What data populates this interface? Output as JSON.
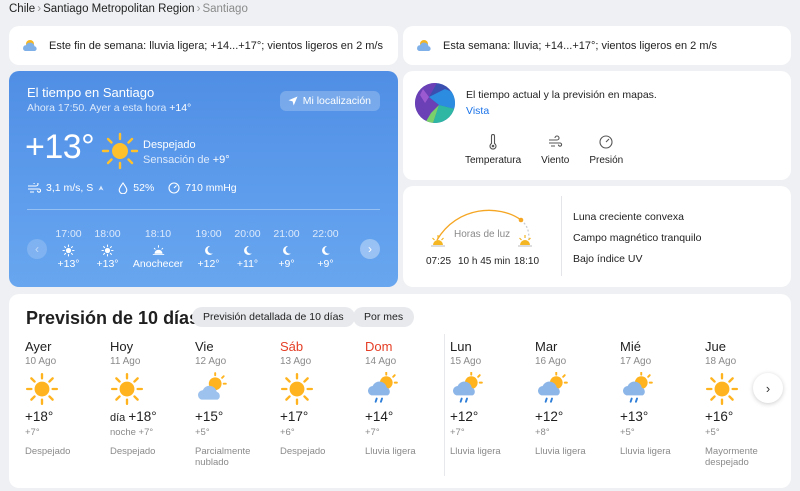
{
  "breadcrumb": {
    "items": [
      "Chile",
      "Santiago Metropolitan Region"
    ],
    "current": "Santiago",
    "separator": "›"
  },
  "weekend_strip": {
    "icon": "partly-cloudy-icon",
    "text": "Este fin de semana: lluvia ligera; +14...+17°; vientos ligeros en 2 m/s"
  },
  "week_strip": {
    "icon": "partly-cloudy-icon",
    "text": "Esta semana: lluvia; +14...+17°; vientos ligeros en 2 m/s"
  },
  "current": {
    "title": "El tiempo en Santiago",
    "subtitle_prefix": "Ahora 17:50. Ayer a esta hora ",
    "subtitle_value": "+14°",
    "location_button": "Mi localización",
    "temperature": "+13°",
    "condition": "Despejado",
    "feels_label": "Sensación de ",
    "feels_value": "+9°",
    "wind": "3,1 m/s, S",
    "humidity": "52%",
    "pressure": "710 mmHg"
  },
  "hourly": [
    {
      "time": "17:00",
      "icon": "sun-icon",
      "value": "+13°"
    },
    {
      "time": "18:00",
      "icon": "sun-icon",
      "value": "+13°"
    },
    {
      "time": "18:10",
      "icon": "sunset-icon",
      "value": "Anochecer"
    },
    {
      "time": "19:00",
      "icon": "moon-icon",
      "value": "+12°"
    },
    {
      "time": "20:00",
      "icon": "moon-icon",
      "value": "+11°"
    },
    {
      "time": "21:00",
      "icon": "moon-icon",
      "value": "+9°"
    },
    {
      "time": "22:00",
      "icon": "moon-icon",
      "value": "+9°"
    }
  ],
  "map_card": {
    "text": "El tiempo actual y la previsión en mapas.",
    "link": "Vista",
    "options": [
      {
        "label": "Temperatura",
        "icon": "thermometer-icon"
      },
      {
        "label": "Viento",
        "icon": "wind-icon"
      },
      {
        "label": "Presión",
        "icon": "pressure-icon"
      }
    ]
  },
  "sun_card": {
    "daylight_label": "Horas de luz",
    "sunrise": "07:25",
    "daylight": "10 h 45 min",
    "sunset": "18:10",
    "facts": [
      "Luna creciente convexa",
      "Campo magnético tranquilo",
      "Bajo índice UV"
    ]
  },
  "forecast": {
    "title": "Previsión de 10 días",
    "detail_button": "Previsión detallada de 10 días",
    "month_button": "Por mes",
    "days": [
      {
        "name": "Ayer",
        "date": "10 Ago",
        "icon": "sun-icon",
        "high_prefix": "",
        "high": "+18°",
        "low": "+7°",
        "condition": "Despejado",
        "weekend": false
      },
      {
        "name": "Hoy",
        "date": "11 Ago",
        "icon": "sun-icon",
        "high_prefix": "día ",
        "high": "+18°",
        "low": "noche +7°",
        "condition": "Despejado",
        "weekend": false
      },
      {
        "name": "Vie",
        "date": "12 Ago",
        "icon": "partly-cloudy-icon",
        "high_prefix": "",
        "high": "+15°",
        "low": "+5°",
        "condition": "Parcialmente nublado",
        "weekend": false
      },
      {
        "name": "Sáb",
        "date": "13 Ago",
        "icon": "sun-icon",
        "high_prefix": "",
        "high": "+17°",
        "low": "+6°",
        "condition": "Despejado",
        "weekend": true
      },
      {
        "name": "Dom",
        "date": "14 Ago",
        "icon": "light-rain-icon",
        "high_prefix": "",
        "high": "+14°",
        "low": "+7°",
        "condition": "Lluvia ligera",
        "weekend": true
      },
      {
        "name": "Lun",
        "date": "15 Ago",
        "icon": "light-rain-icon",
        "high_prefix": "",
        "high": "+12°",
        "low": "+7°",
        "condition": "Lluvia ligera",
        "weekend": false
      },
      {
        "name": "Mar",
        "date": "16 Ago",
        "icon": "light-rain-icon",
        "high_prefix": "",
        "high": "+12°",
        "low": "+8°",
        "condition": "Lluvia ligera",
        "weekend": false
      },
      {
        "name": "Mié",
        "date": "17 Ago",
        "icon": "light-rain-icon",
        "high_prefix": "",
        "high": "+13°",
        "low": "+5°",
        "condition": "Lluvia ligera",
        "weekend": false
      },
      {
        "name": "Jue",
        "date": "18 Ago",
        "icon": "sun-icon",
        "high_prefix": "",
        "high": "+16°",
        "low": "+5°",
        "condition": "Mayormente despejado",
        "weekend": false
      }
    ]
  },
  "colors": {
    "accent_blue": "#4f8ee4",
    "link": "#1a73e8",
    "weekend_red": "#e53e26",
    "sun_yellow": "#f5a623"
  }
}
